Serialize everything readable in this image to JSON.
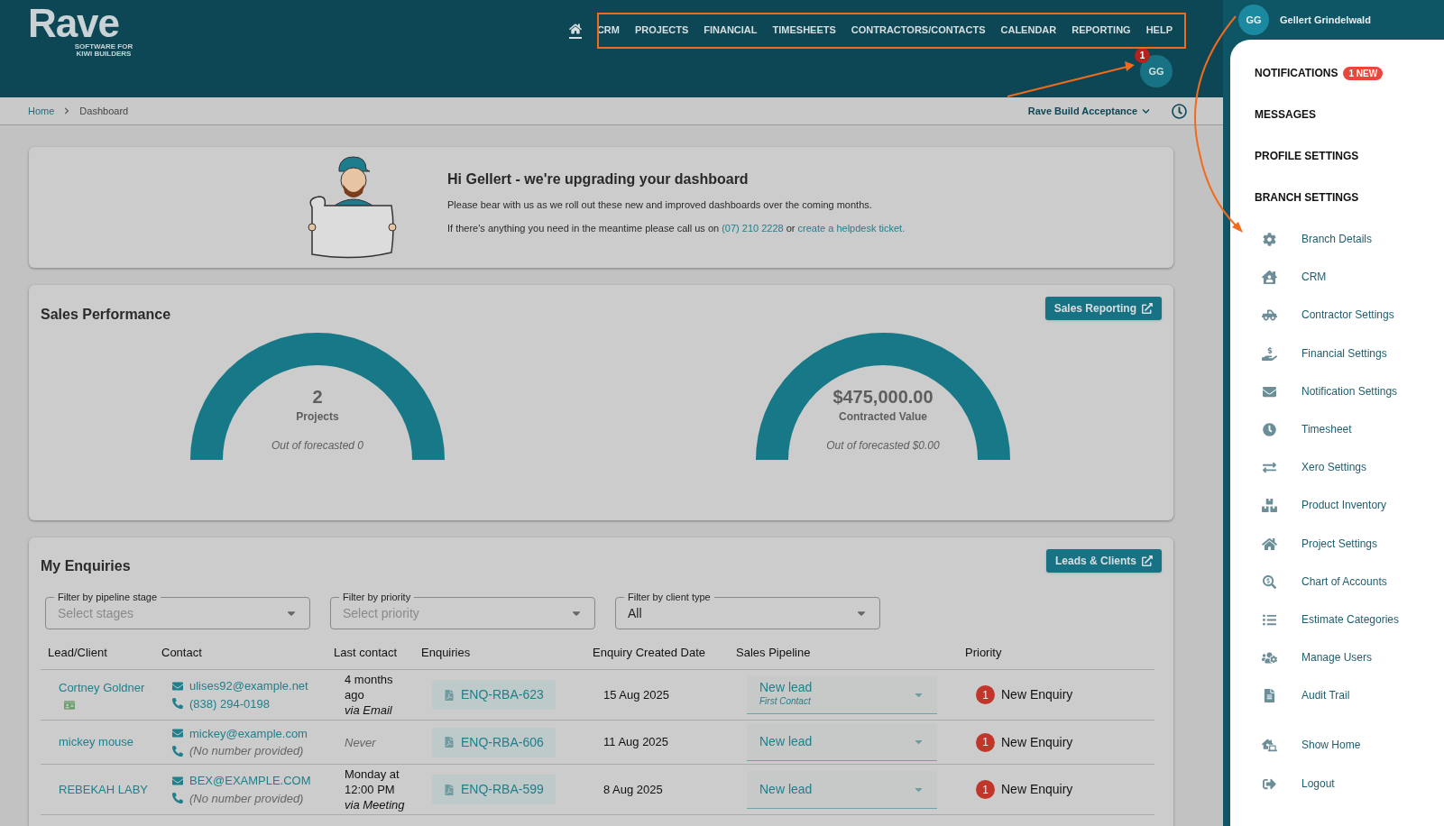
{
  "header": {
    "logo": "Rave",
    "tagline": "SOFTWARE FOR KIWI BUILDERS",
    "nav": [
      {
        "kind": "home",
        "selected": true
      },
      {
        "kind": "text",
        "label": "CRM",
        "selected": false
      },
      {
        "kind": "text",
        "label": "PROJECTS",
        "selected": false
      },
      {
        "kind": "text",
        "label": "FINANCIAL",
        "selected": false
      },
      {
        "kind": "text",
        "label": "TIMESHEETS",
        "selected": false
      },
      {
        "kind": "text",
        "label": "CONTRACTORS/CONTACTS",
        "selected": false
      },
      {
        "kind": "text",
        "label": "CALENDAR",
        "selected": false
      },
      {
        "kind": "text",
        "label": "REPORTING",
        "selected": false
      },
      {
        "kind": "text",
        "label": "HELP",
        "selected": false
      }
    ],
    "avatar": "GG",
    "avatar_badge": "1"
  },
  "breadcrumb": [
    "Home",
    "Dashboard"
  ],
  "branch": "Rave Build Acceptance",
  "banner": {
    "title": "Hi Gellert - we're upgrading your dashboard",
    "line1": "Please bear with us as we roll out these new and improved dashboards over the coming months.",
    "line2_start": "If there's anything you need in the meantime please call us on ",
    "phone": "(07) 210 2228",
    "line2_middle": " or ",
    "link": "create a helpdesk ticket."
  },
  "sales": {
    "title": "Sales Performance",
    "button": "Sales Reporting",
    "gauges": [
      {
        "value": "2",
        "label": "Projects",
        "note": "Out of forecasted 0"
      },
      {
        "value": "$475,000.00",
        "label": "Contracted Value",
        "note": "Out of forecasted $0.00"
      }
    ]
  },
  "enquiries": {
    "title": "My Enquiries",
    "button": "Leads & Clients",
    "filters": [
      {
        "label": "Filter by pipeline stage",
        "placeholder": "Select stages"
      },
      {
        "label": "Filter by priority",
        "placeholder": "Select priority"
      },
      {
        "label": "Filter by client type",
        "value": "All"
      }
    ],
    "columns": [
      "Lead/Client",
      "Contact",
      "Last contact",
      "Enquiries",
      "Enquiry Created Date",
      "Sales Pipeline",
      "Priority"
    ],
    "rows": [
      {
        "client": "Cortney Goldner",
        "card_icon": true,
        "email": "ulises92@example.net",
        "phone": "(838) 294-0198",
        "phone_missing": false,
        "last_contact": "4 months ago",
        "never": false,
        "via": "via Email",
        "enquiry": "ENQ-RBA-623",
        "date": "15 Aug 2025",
        "pipeline": "New lead",
        "pipeline_sub": "First Contact",
        "priority_count": "1",
        "priority": "New Enquiry"
      },
      {
        "client": "mickey mouse",
        "card_icon": false,
        "email": "mickey@example.com",
        "phone": "(No number provided)",
        "phone_missing": true,
        "last_contact": "Never",
        "never": true,
        "enquiry": "ENQ-RBA-606",
        "date": "11 Aug 2025",
        "pipeline": "New lead",
        "priority_count": "1",
        "priority": "New Enquiry"
      },
      {
        "client": "REBEKAH LABY",
        "card_icon": false,
        "email": "BEX@EXAMPLE.COM",
        "phone": "(No number provided)",
        "phone_missing": true,
        "last_contact": "Monday at 12:00 PM",
        "never": false,
        "via": "via Meeting",
        "enquiry": "ENQ-RBA-599",
        "date": "8 Aug 2025",
        "pipeline": "New lead",
        "priority_count": "1",
        "priority": "New Enquiry"
      }
    ]
  },
  "drawer": {
    "avatar": "GG",
    "user": "Gellert Grindelwald",
    "sections": [
      {
        "label": "NOTIFICATIONS",
        "badge": "1 NEW"
      },
      {
        "label": "MESSAGES"
      },
      {
        "label": "PROFILE SETTINGS"
      },
      {
        "label": "BRANCH SETTINGS"
      }
    ],
    "items": [
      "Branch Details",
      "CRM",
      "Contractor Settings",
      "Financial Settings",
      "Notification Settings",
      "Timesheet",
      "Xero Settings",
      "Product Inventory",
      "Project Settings",
      "Chart of Accounts",
      "Estimate Categories",
      "Manage Users",
      "Audit Trail"
    ],
    "footer_items": [
      "Show Home",
      "Logout"
    ]
  }
}
